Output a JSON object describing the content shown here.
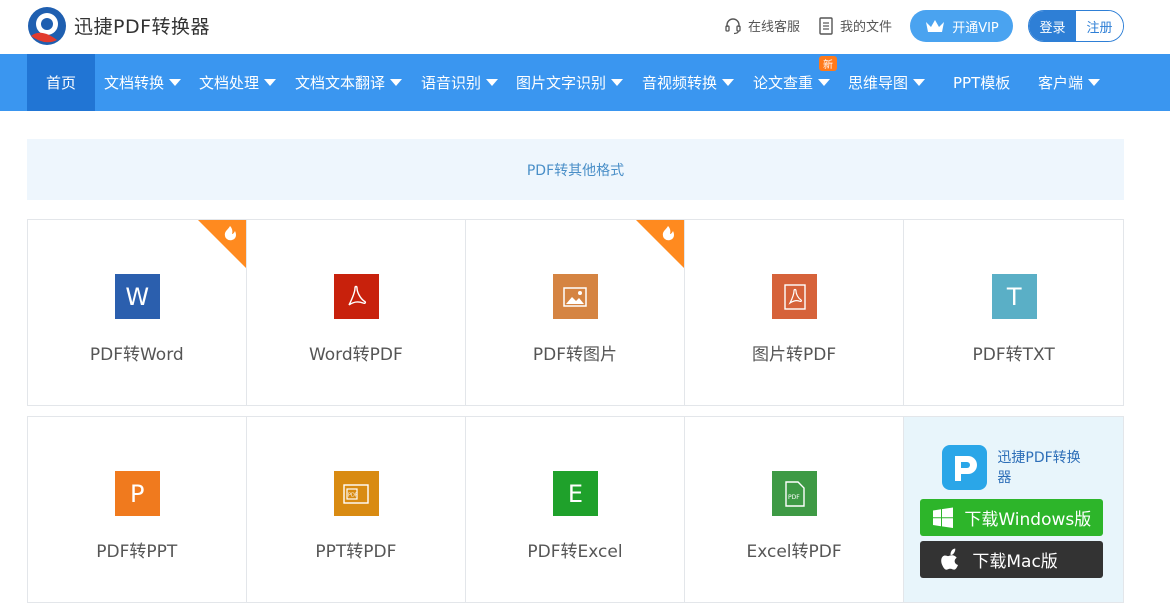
{
  "header": {
    "brand": "迅捷PDF转换器",
    "service_label": "在线客服",
    "files_label": "我的文件",
    "vip_label": "开通VIP",
    "login_label": "登录",
    "register_label": "注册"
  },
  "nav": {
    "items": [
      {
        "label": "首页",
        "dropdown": false
      },
      {
        "label": "文档转换",
        "dropdown": true
      },
      {
        "label": "文档处理",
        "dropdown": true
      },
      {
        "label": "文档文本翻译",
        "dropdown": true
      },
      {
        "label": "语音识别",
        "dropdown": true
      },
      {
        "label": "图片文字识别",
        "dropdown": true
      },
      {
        "label": "音视频转换",
        "dropdown": true
      },
      {
        "label": "论文查重",
        "dropdown": true
      },
      {
        "label": "思维导图",
        "dropdown": true
      },
      {
        "label": "PPT模板",
        "dropdown": false
      },
      {
        "label": "客户端",
        "dropdown": true
      }
    ],
    "new_badge": "新"
  },
  "section": {
    "title": "PDF转其他格式"
  },
  "tools_row1": [
    {
      "label": "PDF转Word",
      "icon": "word-icon",
      "color": "#2b5fae",
      "hot": true
    },
    {
      "label": "Word转PDF",
      "icon": "acrobat-icon",
      "color": "#c8210c",
      "hot": false
    },
    {
      "label": "PDF转图片",
      "icon": "image-icon",
      "color": "#d58442",
      "hot": true
    },
    {
      "label": "图片转PDF",
      "icon": "acrobat-icon",
      "color": "#d6623a",
      "hot": false
    },
    {
      "label": "PDF转TXT",
      "icon": "text-icon",
      "color": "#5aafc6",
      "hot": false
    }
  ],
  "tools_row2": [
    {
      "label": "PDF转PPT",
      "icon": "powerpoint-icon",
      "color": "#f07a1e"
    },
    {
      "label": "PPT转PDF",
      "icon": "ppt-pdf-icon",
      "color": "#d98b12"
    },
    {
      "label": "PDF转Excel",
      "icon": "excel-icon",
      "color": "#1fa12b"
    },
    {
      "label": "Excel转PDF",
      "icon": "pdf-doc-icon",
      "color": "#3e9a45"
    }
  ],
  "download": {
    "app_name": "迅捷PDF转换器",
    "windows_label": "下载Windows版",
    "mac_label": "下载Mac版"
  },
  "colors": {
    "nav_bg": "#3a96f0",
    "nav_active": "#2175d4",
    "accent": "#2e7fd6"
  }
}
